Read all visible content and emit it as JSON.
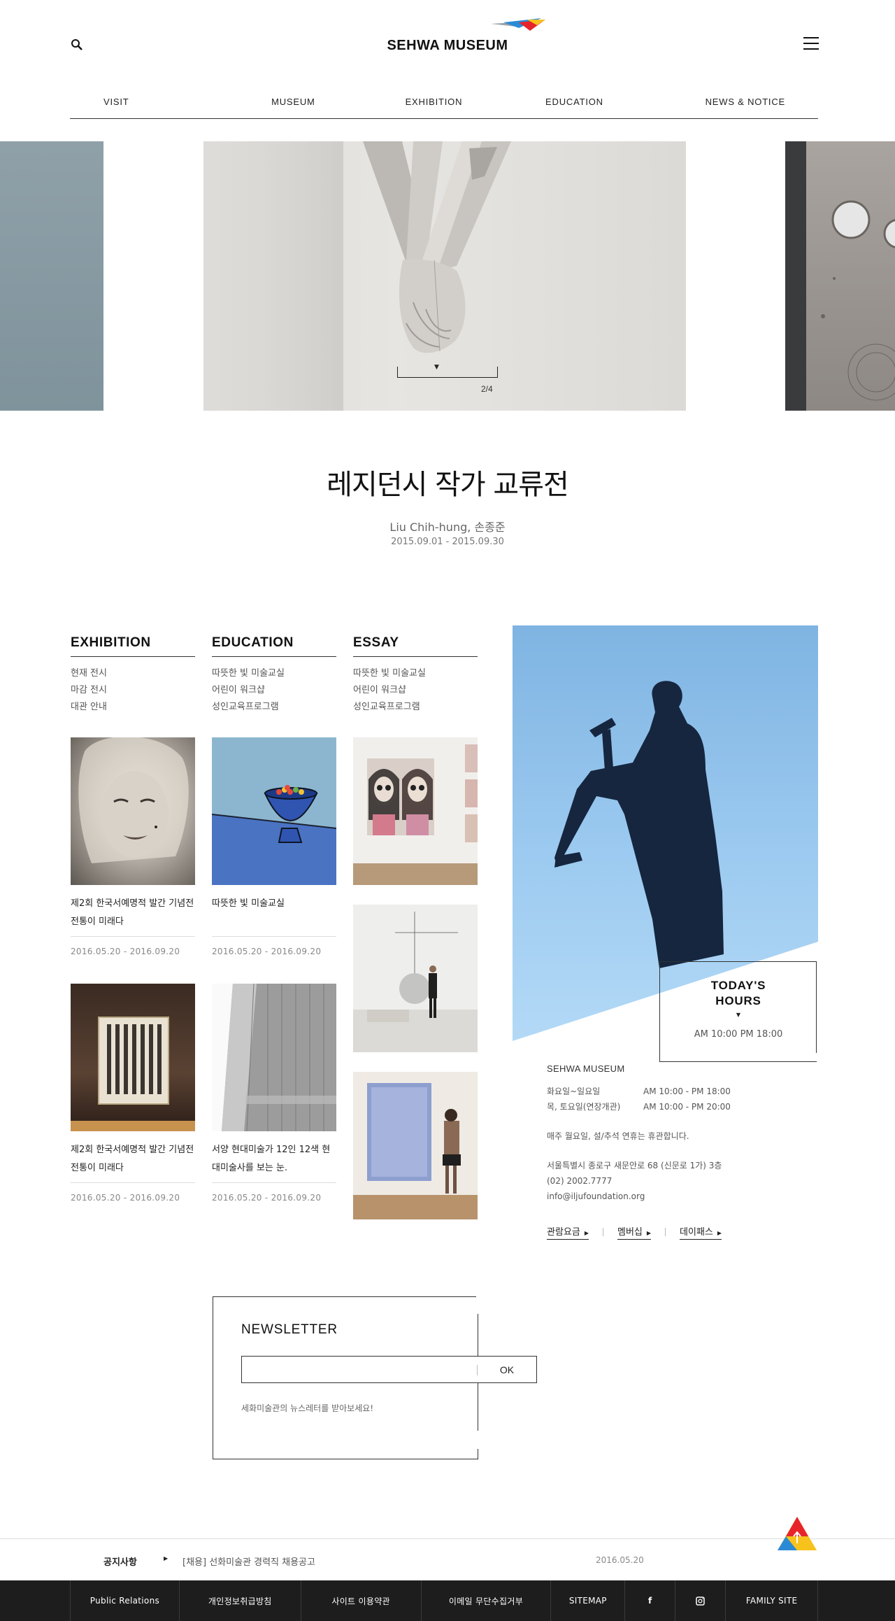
{
  "header": {
    "logo_text": "SEHWA MUSEUM",
    "nav": [
      "VISIT",
      "MUSEUM",
      "EXHIBITION",
      "EDUCATION",
      "NEWS & NOTICE"
    ]
  },
  "hero": {
    "page": "2/4",
    "title": "레지던시 작가 교류전",
    "artist": "Liu Chih-hung, 손종준",
    "date": "2015.09.01 - 2015.09.30"
  },
  "exhibition": {
    "heading": "EXHIBITION",
    "links": [
      "현재 전시",
      "마감 전시",
      "대관 안내"
    ],
    "cards": [
      {
        "caption": "제2회 한국서예명적 발간 기념전 전통이 미래다",
        "date": "2016.05.20 - 2016.09.20"
      },
      {
        "caption": "제2회 한국서예명적 발간 기념전 전통이 미래다",
        "date": "2016.05.20 - 2016.09.20"
      }
    ]
  },
  "education": {
    "heading": "EDUCATION",
    "links": [
      "따뜻한 빛 미술교실",
      "어린이 워크샵",
      "성인교육프로그램"
    ],
    "cards": [
      {
        "caption": "따뜻한 빛 미술교실",
        "date": "2016.05.20 - 2016.09.20"
      },
      {
        "caption": "서양 현대미술가 12인 12색 현대미술사를 보는 눈.",
        "date": "2016.05.20 - 2016.09.20"
      }
    ]
  },
  "essay": {
    "heading": "ESSAY",
    "links": [
      "따뜻한 빛 미술교실",
      "어린이 워크샵",
      "성인교육프로그램"
    ]
  },
  "hours": {
    "title_line1": "TODAY'S",
    "title_line2": "HOURS",
    "time": "AM 10:00 PM 18:00"
  },
  "info": {
    "name": "SEHWA MUSEUM",
    "rows": [
      {
        "k": "화요일~일요일",
        "v": "AM 10:00 - PM 18:00"
      },
      {
        "k": "목, 토요일(연장개관)",
        "v": "AM 10:00 - PM 20:00"
      }
    ],
    "closed": "매주 월요일, 설/추석 연휴는 휴관합니다.",
    "address": "서울특별시 종로구 새문안로 68 (신문로 1가) 3층",
    "phone": "(02) 2002.7777",
    "email": "info@iljufoundation.org",
    "links": [
      "관람요금",
      "멤버십",
      "데이패스"
    ]
  },
  "newsletter": {
    "title": "NEWSLETTER",
    "placeholder": "",
    "button": "OK",
    "desc": "세화미술관의 뉴스레터를 받아보세요!"
  },
  "notice": {
    "label": "공지사항",
    "text": "[채용] 선화미술관 경력직 채용공고",
    "date": "2016.05.20"
  },
  "footer": {
    "items": [
      "Public Relations",
      "개인정보취급방침",
      "사이트 이용약관",
      "이메일 무단수집거부",
      "SITEMAP",
      "f",
      "instagram",
      "FAMILY SITE"
    ]
  },
  "colors": {
    "footer_bg": "#1d1d1d",
    "sky": "#8fc3ee",
    "logo_red": "#e8242b",
    "logo_yellow": "#f6c21b",
    "logo_blue": "#2b8ad6"
  }
}
